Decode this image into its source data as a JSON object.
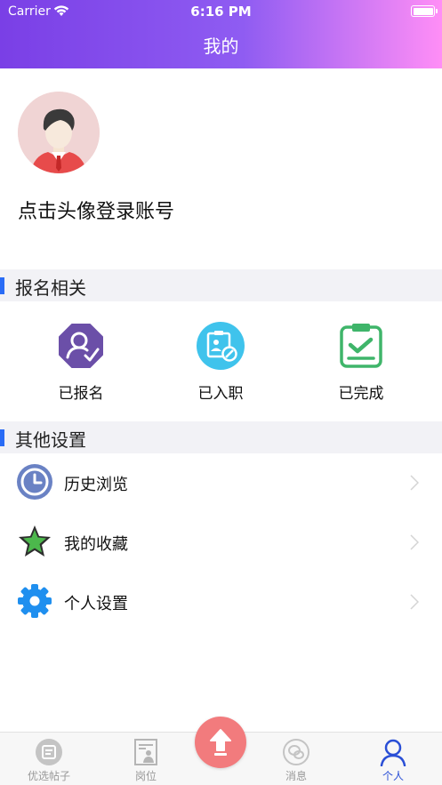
{
  "status_bar": {
    "carrier": "Carrier",
    "time": "6:16 PM"
  },
  "nav": {
    "title": "我的"
  },
  "profile": {
    "login_prompt": "点击头像登录账号"
  },
  "registration": {
    "section_title": "报名相关",
    "items": [
      {
        "label": "已报名",
        "icon": "registered-icon",
        "color": "#6b4fa8"
      },
      {
        "label": "已入职",
        "icon": "onboarded-icon",
        "color": "#3fc3ec"
      },
      {
        "label": "已完成",
        "icon": "completed-icon",
        "color": "#3fb56a"
      }
    ]
  },
  "settings": {
    "section_title": "其他设置",
    "items": [
      {
        "label": "历史浏览",
        "icon": "clock-icon"
      },
      {
        "label": "我的收藏",
        "icon": "star-icon"
      },
      {
        "label": "个人设置",
        "icon": "gear-icon"
      }
    ]
  },
  "tabbar": {
    "tabs": [
      {
        "label": "优选帖子",
        "icon": "post-icon",
        "active": false
      },
      {
        "label": "岗位",
        "icon": "job-icon",
        "active": false
      },
      {
        "label": "消息",
        "icon": "message-icon",
        "active": false
      },
      {
        "label": "个人",
        "icon": "person-icon",
        "active": true
      }
    ],
    "fab_icon": "upload-arrow-icon"
  },
  "colors": {
    "accent": "#2a6cf6",
    "header_start": "#7a3fe6",
    "header_end": "#ff8ef6",
    "active_tab": "#2a4fd6",
    "fab": "#f27b7d"
  }
}
